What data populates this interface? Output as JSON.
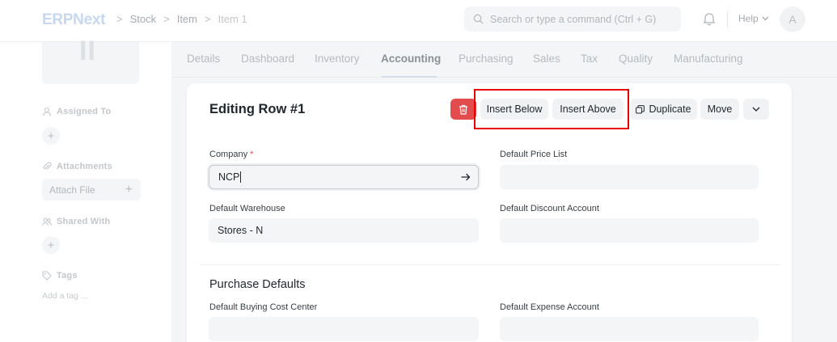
{
  "navbar": {
    "logo": "ERPNext",
    "breadcrumbs": [
      "Stock",
      "Item",
      "Item 1"
    ],
    "search_placeholder": "Search or type a command (Ctrl + G)",
    "help_label": "Help",
    "avatar_initial": "A"
  },
  "sidebar": {
    "image_initials": "II",
    "assigned_to_label": "Assigned To",
    "attachments_label": "Attachments",
    "attach_file_label": "Attach File",
    "shared_with_label": "Shared With",
    "tags_label": "Tags",
    "add_tag_label": "Add a tag ..."
  },
  "tabs": [
    "Details",
    "Dashboard",
    "Inventory",
    "Accounting",
    "Purchasing",
    "Sales",
    "Tax",
    "Quality",
    "Manufacturing"
  ],
  "active_tab": "Accounting",
  "form": {
    "title": "Editing Row #1",
    "buttons": {
      "insert_below": "Insert Below",
      "insert_above": "Insert Above",
      "duplicate": "Duplicate",
      "move": "Move"
    },
    "fields": {
      "company_label": "Company",
      "company_required_mark": "*",
      "company_value": "NCP",
      "default_price_list_label": "Default Price List",
      "default_price_list_value": "",
      "default_warehouse_label": "Default Warehouse",
      "default_warehouse_value": "Stores - N",
      "default_discount_account_label": "Default Discount Account",
      "default_discount_account_value": ""
    },
    "purchase_section_title": "Purchase Defaults",
    "purchase_fields": {
      "buying_cost_center_label": "Default Buying Cost Center",
      "buying_cost_center_value": "",
      "expense_account_label": "Default Expense Account",
      "expense_account_value": ""
    }
  },
  "colors": {
    "delete_button": "#e24c4c",
    "highlight_box": "#e60000",
    "required_mark": "#e24c4c"
  },
  "icons": [
    "search-icon",
    "bell-icon",
    "chevron-down-icon",
    "user-icon",
    "paperclip-icon",
    "share-icon",
    "tag-icon",
    "trash-icon",
    "duplicate-icon",
    "arrow-right-icon",
    "plus-icon"
  ]
}
